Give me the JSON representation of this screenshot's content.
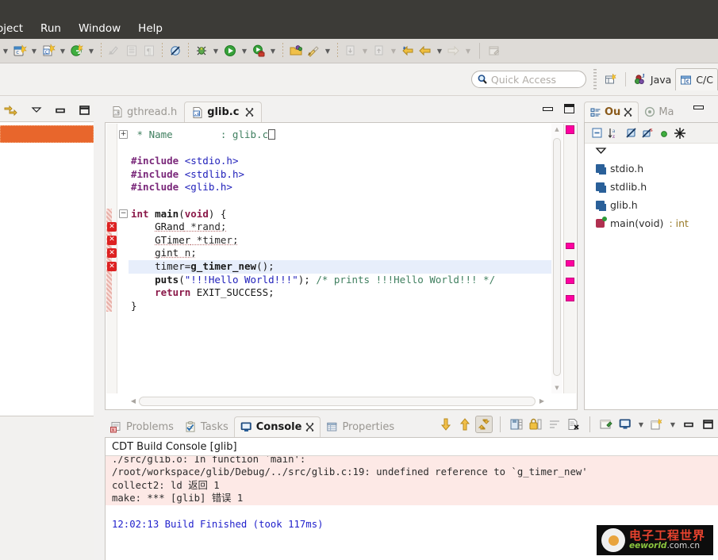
{
  "menubar": {
    "items": [
      {
        "label": "oject",
        "clipped": true
      },
      {
        "label": "Run"
      },
      {
        "label": "Window"
      },
      {
        "label": "Help"
      }
    ]
  },
  "toolbar": {
    "groups": [
      {
        "name": "new-wizard",
        "items": [
          {
            "icon": "new-project-icon",
            "arrow": true
          },
          {
            "icon": "new-c-file-icon",
            "arrow": true
          },
          {
            "icon": "new-gtk-icon",
            "arrow": true
          }
        ]
      },
      {
        "name": "edit-tools",
        "items": [
          {
            "icon": "save-icon",
            "dim": true
          },
          {
            "icon": "print-icon",
            "dim": true
          },
          {
            "icon": "paragraph-icon",
            "dim": true
          }
        ]
      },
      {
        "name": "marker-tools",
        "items": [
          {
            "icon": "skip-breakpoints-icon"
          }
        ]
      },
      {
        "name": "run-debug",
        "items": [
          {
            "icon": "debug-icon",
            "arrow": true
          },
          {
            "icon": "run-icon",
            "arrow": true
          },
          {
            "icon": "external-tools-icon",
            "arrow": true
          }
        ]
      },
      {
        "name": "build-tools",
        "items": [
          {
            "icon": "open-element-icon"
          },
          {
            "icon": "build-icon",
            "arrow": true
          }
        ]
      },
      {
        "name": "nav-tools",
        "items": [
          {
            "icon": "next-annotation-icon",
            "dim": true,
            "arrow": true
          },
          {
            "icon": "previous-annotation-icon",
            "dim": true,
            "arrow": true
          }
        ]
      },
      {
        "name": "history-tools",
        "items": [
          {
            "icon": "back-icon"
          },
          {
            "icon": "forward-icon",
            "arrow": true
          },
          {
            "icon": "forward-disabled-icon",
            "dim": true,
            "arrow": true
          }
        ]
      },
      {
        "name": "misc-tools",
        "items": [
          {
            "icon": "new-editor-icon",
            "dim": true
          }
        ]
      }
    ]
  },
  "quick_access": {
    "placeholder": "Quick Access",
    "value": "",
    "icon": "search-icon"
  },
  "perspective": {
    "open_perspective_icon": "open-perspective-icon",
    "items": [
      {
        "label": "Java",
        "icon": "java-perspective-icon",
        "selected": false
      },
      {
        "label": "C/C",
        "icon": "cpp-perspective-icon",
        "selected": true
      }
    ]
  },
  "left_panel": {
    "view_menu_icon": "view-menu-icon",
    "minimize_icon": "minimize-icon",
    "maximize_icon": "maximize-icon",
    "selected_row_color": "#e8662c"
  },
  "editor": {
    "tabs": [
      {
        "label": "gthread.h",
        "icon": "h-file-icon",
        "active": false,
        "closable": false
      },
      {
        "label": "glib.c",
        "icon": "c-file-icon",
        "active": true,
        "closable": true
      }
    ],
    "minimize_icon": "minimize-icon",
    "maximize_icon": "maximize-icon",
    "code_lines": [
      {
        "n": 1,
        "indent": 0,
        "tokens": [
          {
            "t": " * Name        : glib.c",
            "c": "k-cmt"
          }
        ],
        "fold": "plus",
        "comment_head": true
      },
      {
        "n": 2,
        "indent": 0,
        "tokens": []
      },
      {
        "n": 3,
        "indent": 0,
        "tokens": [
          {
            "t": "#include ",
            "c": "k-pre"
          },
          {
            "t": "<stdio.h>",
            "c": "k-inc"
          }
        ]
      },
      {
        "n": 4,
        "indent": 0,
        "tokens": [
          {
            "t": "#include ",
            "c": "k-pre"
          },
          {
            "t": "<stdlib.h>",
            "c": "k-inc"
          }
        ]
      },
      {
        "n": 5,
        "indent": 0,
        "tokens": [
          {
            "t": "#include ",
            "c": "k-pre"
          },
          {
            "t": "<glib.h>",
            "c": "k-inc"
          }
        ]
      },
      {
        "n": 6,
        "indent": 0,
        "tokens": []
      },
      {
        "n": 7,
        "indent": 0,
        "tokens": [
          {
            "t": "int ",
            "c": "k-kw"
          },
          {
            "t": "main",
            "c": "k-fn"
          },
          {
            "t": "(",
            "c": "k-id"
          },
          {
            "t": "void",
            "c": "k-kw"
          },
          {
            "t": ") {",
            "c": "k-id"
          }
        ],
        "fold": "minus"
      },
      {
        "n": 8,
        "indent": 1,
        "tokens": [
          {
            "t": "GRand",
            "c": "k-typ"
          },
          {
            "t": " *rand;",
            "c": "k-und"
          }
        ],
        "error": true
      },
      {
        "n": 9,
        "indent": 1,
        "tokens": [
          {
            "t": "GTimer",
            "c": "k-typ"
          },
          {
            "t": " *timer;",
            "c": "k-und"
          }
        ],
        "error": true
      },
      {
        "n": 10,
        "indent": 1,
        "tokens": [
          {
            "t": "gint",
            "c": "k-typ"
          },
          {
            "t": " n;",
            "c": "k-und"
          }
        ],
        "error": true
      },
      {
        "n": 11,
        "indent": 1,
        "tokens": [
          {
            "t": "timer=",
            "c": "k-id"
          },
          {
            "t": "g_timer_new",
            "c": "k-fn"
          },
          {
            "t": "();",
            "c": "k-id"
          }
        ],
        "error": true,
        "highlight": true
      },
      {
        "n": 12,
        "indent": 1,
        "tokens": [
          {
            "t": "puts",
            "c": "k-fn"
          },
          {
            "t": "(",
            "c": "k-id"
          },
          {
            "t": "\"!!!Hello World!!!\"",
            "c": "k-str"
          },
          {
            "t": "); ",
            "c": "k-id"
          },
          {
            "t": "/* prints !!!Hello World!!! */",
            "c": "k-cmt"
          }
        ]
      },
      {
        "n": 13,
        "indent": 1,
        "tokens": [
          {
            "t": "return ",
            "c": "k-kw"
          },
          {
            "t": "EXIT_SUCCESS;",
            "c": "k-cst"
          }
        ]
      },
      {
        "n": 14,
        "indent": 0,
        "tokens": [
          {
            "t": "}",
            "c": "k-id"
          }
        ]
      }
    ],
    "overview_markers": 4,
    "error_marker_color": "#ff00a0"
  },
  "outline": {
    "tabs": [
      {
        "label": "Ou",
        "icon": "outline-icon",
        "active": true,
        "closable": true
      },
      {
        "label": "Ma",
        "icon": "make-target-icon",
        "active": false,
        "closable": false
      }
    ],
    "minimize_icon": "minimize-icon",
    "toolbar_icons": [
      "collapse-all-icon",
      "sort-az-icon",
      "hide-fields-icon",
      "hide-static-icon",
      "hide-nonpublic-icon",
      "filter-icon"
    ],
    "menu_icon": "view-menu-chevron-icon",
    "items": [
      {
        "label": "stdio.h",
        "icon": "include-icon",
        "type": "include"
      },
      {
        "label": "stdlib.h",
        "icon": "include-icon",
        "type": "include"
      },
      {
        "label": "glib.h",
        "icon": "include-icon",
        "type": "include"
      },
      {
        "label": "main(void)",
        "suffix": " : int",
        "icon": "function-icon",
        "type": "function"
      }
    ]
  },
  "console": {
    "tabs": [
      {
        "label": "Problems",
        "icon": "problems-icon",
        "active": false,
        "closable": false
      },
      {
        "label": "Tasks",
        "icon": "tasks-icon",
        "active": false,
        "closable": false
      },
      {
        "label": "Console",
        "icon": "console-icon",
        "active": true,
        "closable": true
      },
      {
        "label": "Properties",
        "icon": "properties-icon",
        "active": false,
        "closable": false
      }
    ],
    "toolbar_icons": [
      {
        "name": "scroll-down-icon",
        "pressed": false
      },
      {
        "name": "scroll-up-icon",
        "pressed": false
      },
      {
        "name": "scroll-lock-icon",
        "pressed": true
      },
      {
        "name": "save-console-icon",
        "pressed": false
      },
      {
        "name": "lock-console-icon",
        "pressed": false
      },
      {
        "name": "wrap-icon",
        "pressed": false
      },
      {
        "name": "clear-console-icon",
        "pressed": false
      },
      {
        "name": "pin-console-icon",
        "pressed": false
      },
      {
        "name": "display-console-icon",
        "pressed": false,
        "arrow": true
      },
      {
        "name": "new-console-icon",
        "pressed": false,
        "arrow": true
      }
    ],
    "minimize_icon": "minimize-icon",
    "maximize_icon": "maximize-icon",
    "title": "CDT Build Console [glib]",
    "lines": [
      {
        "text": "./src/glib.o: In function `main':",
        "style": "err",
        "clipped_top": true
      },
      {
        "text": "/root/workspace/glib/Debug/../src/glib.c:19: undefined reference to `g_timer_new'",
        "style": "err"
      },
      {
        "text": "collect2: ld 返回 1",
        "style": "err"
      },
      {
        "text": "make: *** [glib] 错误 1",
        "style": "err"
      },
      {
        "text": "",
        "style": "plain"
      },
      {
        "text": "12:02:13 Build Finished (took 117ms)",
        "style": "info"
      }
    ]
  },
  "watermark": {
    "chinese": "电子工程世界",
    "domain_bold": "eeworld",
    "domain_rest": ".com.cn",
    "logo_icon": "eeworld-logo-icon"
  }
}
